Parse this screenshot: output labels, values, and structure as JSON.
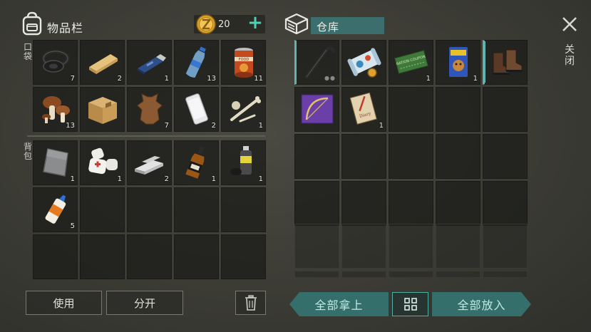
{
  "inventory": {
    "title": "物品栏",
    "coins": "20",
    "plus_symbol": "+",
    "pocket_label": "口袋",
    "backpack_label": "背包",
    "pocket_items": [
      {
        "icon": "tire-icon",
        "qty": "7"
      },
      {
        "icon": "wood-plank-icon",
        "qty": "2"
      },
      {
        "icon": "usb-drive-icon",
        "qty": "1"
      },
      {
        "icon": "water-bottle-icon",
        "qty": "13"
      },
      {
        "icon": "canned-food-icon",
        "qty": "11"
      },
      {
        "icon": "mushroom-icon",
        "qty": "13"
      },
      {
        "icon": "cardboard-box-icon",
        "qty": ""
      },
      {
        "icon": "animal-hide-icon",
        "qty": "7"
      },
      {
        "icon": "smartphone-icon",
        "qty": "2"
      },
      {
        "icon": "bones-icon",
        "qty": "1"
      }
    ],
    "backpack_items": [
      {
        "icon": "metal-plate-icon",
        "qty": "1"
      },
      {
        "icon": "bandage-icon",
        "qty": "1"
      },
      {
        "icon": "metal-ingot-icon",
        "qty": "2"
      },
      {
        "icon": "whiskey-bottle-icon",
        "qty": "1"
      },
      {
        "icon": "spray-can-icon",
        "qty": "1"
      },
      {
        "icon": "glue-tube-icon",
        "qty": "5"
      }
    ],
    "backpack_total_slots": 15
  },
  "storage": {
    "title": "仓库",
    "items": [
      {
        "icon": "crowbar-icon",
        "qty": ""
      },
      {
        "icon": "map-scroll-icon",
        "qty": ""
      },
      {
        "icon": "ration-coupon-icon",
        "qty": "1"
      },
      {
        "icon": "dog-food-icon",
        "qty": "1"
      },
      {
        "icon": "boots-icon",
        "qty": ""
      },
      {
        "icon": "bow-blueprint-icon",
        "qty": ""
      },
      {
        "icon": "diary-icon",
        "qty": "1"
      }
    ],
    "total_slots": 20,
    "locked_slots": 10,
    "coupon_text": "RATION COUPON",
    "food_can_text": "FOOD",
    "diary_text": "Diary"
  },
  "close_label": "关闭",
  "buttons": {
    "use": "使用",
    "split": "分开",
    "take_all": "全部拿上",
    "put_all": "全部放入"
  },
  "colors": {
    "accent_teal": "#356f6c",
    "accent_bright": "#4fd0b4",
    "coin_gold": "#d9a22a"
  }
}
